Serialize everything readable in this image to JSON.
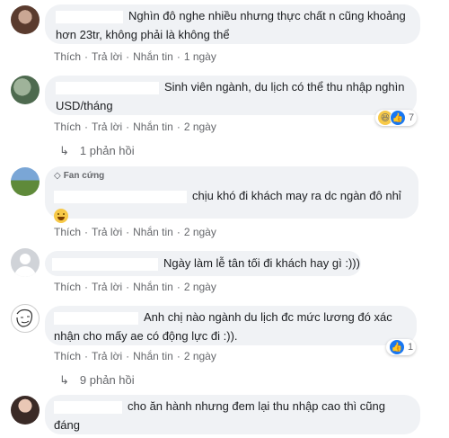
{
  "comments": [
    {
      "lines": [
        "Nghìn đô nghe nhiều nhưng thực chất n cũng khoảng",
        "hơn 23tr, không phải là không thể"
      ],
      "actions": {
        "like": "Thích",
        "reply": "Trả lời",
        "message": "Nhắn tin",
        "time": "1 ngày"
      }
    },
    {
      "lines": [
        "Sinh viên ngành, du lịch có thể thu nhập nghìn",
        "USD/tháng"
      ],
      "reactions_count": "7",
      "actions": {
        "like": "Thích",
        "reply": "Trả lời",
        "message": "Nhắn tin",
        "time": "2 ngày"
      },
      "replies": "1 phản hồi"
    },
    {
      "badge": "Fan cứng",
      "lines": [
        "chịu khó đi khách may ra dc ngàn đô nhỉ"
      ],
      "actions": {
        "like": "Thích",
        "reply": "Trả lời",
        "message": "Nhắn tin",
        "time": "2 ngày"
      }
    },
    {
      "lines": [
        "Ngày làm lễ tân tối đi khách hay gì :)))"
      ],
      "actions": {
        "like": "Thích",
        "reply": "Trả lời",
        "message": "Nhắn tin",
        "time": "2 ngày"
      }
    },
    {
      "lines": [
        "Anh chị nào ngành du lịch đc mức lương đó xác",
        "nhận cho mấy ae có động lực đi :))."
      ],
      "reactions_count": "1",
      "actions": {
        "like": "Thích",
        "reply": "Trả lời",
        "message": "Nhắn tin",
        "time": "2 ngày"
      },
      "replies": "9 phản hồi"
    },
    {
      "lines": [
        "cho ăn hành nhưng đem lại thu nhập cao thì cũng",
        "đáng"
      ]
    }
  ],
  "colors": {
    "bubble": "#f0f2f5",
    "meta": "#65676b",
    "like_blue": "#1877f2",
    "haha_yellow": "#f7c948"
  },
  "icons": [
    "haha-reaction-icon",
    "like-reaction-icon",
    "reply-arrow-icon",
    "gem-badge-icon",
    "grinning-emoji-icon"
  ]
}
